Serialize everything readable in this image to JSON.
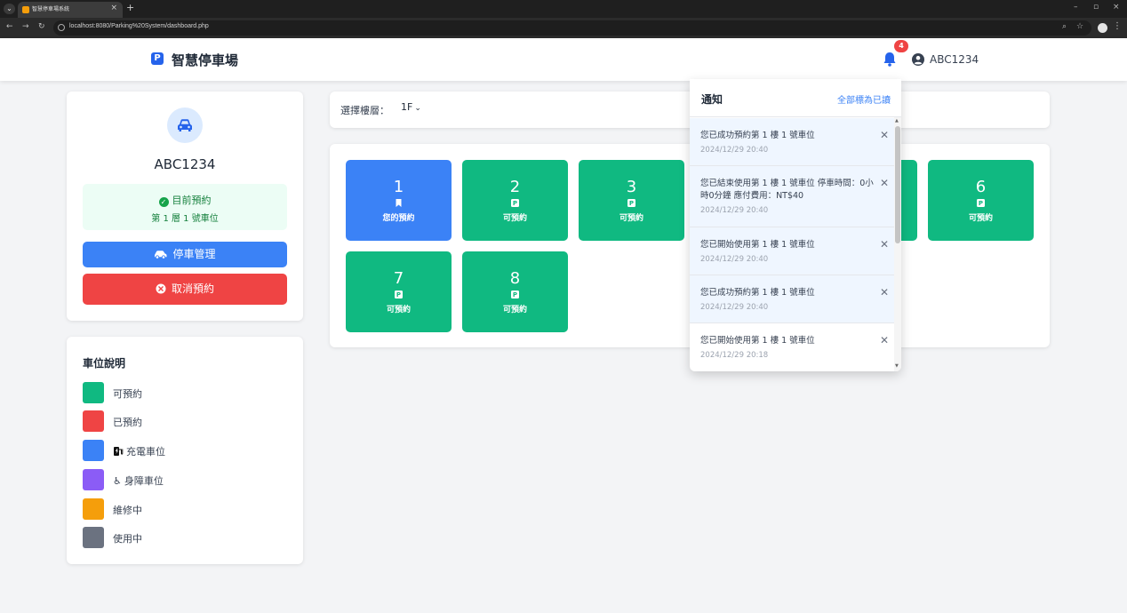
{
  "browser": {
    "tab_title": "智慧停車場系統",
    "url": "localhost:8080/Parking%20System/dashboard.php"
  },
  "header": {
    "brand_logo": "P",
    "brand_name": "智慧停車場",
    "notification_count": "4",
    "username": "ABC1234"
  },
  "profile": {
    "plate": "ABC1234",
    "reservation_title": "目前預約",
    "reservation_detail": "第 1 層 1 號車位",
    "manage_label": "停車管理",
    "cancel_label": "取消預約"
  },
  "legend": {
    "title": "車位說明",
    "items": [
      {
        "label": "可預約",
        "color": "#10b981"
      },
      {
        "label": "已預約",
        "color": "#ef4444"
      },
      {
        "label": "充電車位",
        "color": "#3b82f6",
        "icon": "ev-charger-icon"
      },
      {
        "label": "身障車位",
        "color": "#8b5cf6",
        "icon": "wheelchair-icon"
      },
      {
        "label": "維修中",
        "color": "#f59e0b"
      },
      {
        "label": "使用中",
        "color": "#6b7280"
      }
    ]
  },
  "floor": {
    "label": "選擇樓層：",
    "selected": "1F"
  },
  "spots": [
    {
      "number": "1",
      "status": "您的預約",
      "icon": "bookmark-icon",
      "color": "#3b82f6"
    },
    {
      "number": "2",
      "status": "可預約",
      "icon": "parking-icon",
      "color": "#10b981"
    },
    {
      "number": "3",
      "status": "可預約",
      "icon": "parking-icon",
      "color": "#10b981"
    },
    {
      "number": "6",
      "status": "可預約",
      "icon": "parking-icon",
      "color": "#10b981"
    },
    {
      "number": "7",
      "status": "可預約",
      "icon": "parking-icon",
      "color": "#10b981"
    },
    {
      "number": "8",
      "status": "可預約",
      "icon": "parking-icon",
      "color": "#10b981"
    }
  ],
  "notifications": {
    "title": "通知",
    "mark_all_read": "全部標為已讀",
    "items": [
      {
        "message": "您已成功預約第 1 樓 1 號車位",
        "time": "2024/12/29 20:40",
        "unread": true
      },
      {
        "message": "您已結束使用第 1 樓 1 號車位 停車時間：0小時0分鐘 應付費用：NT$40",
        "time": "2024/12/29 20:40",
        "unread": true
      },
      {
        "message": "您已開始使用第 1 樓 1 號車位",
        "time": "2024/12/29 20:40",
        "unread": true
      },
      {
        "message": "您已成功預約第 1 樓 1 號車位",
        "time": "2024/12/29 20:40",
        "unread": true
      },
      {
        "message": "您已開始使用第 1 樓 1 號車位",
        "time": "2024/12/29 20:18",
        "unread": false
      }
    ]
  }
}
